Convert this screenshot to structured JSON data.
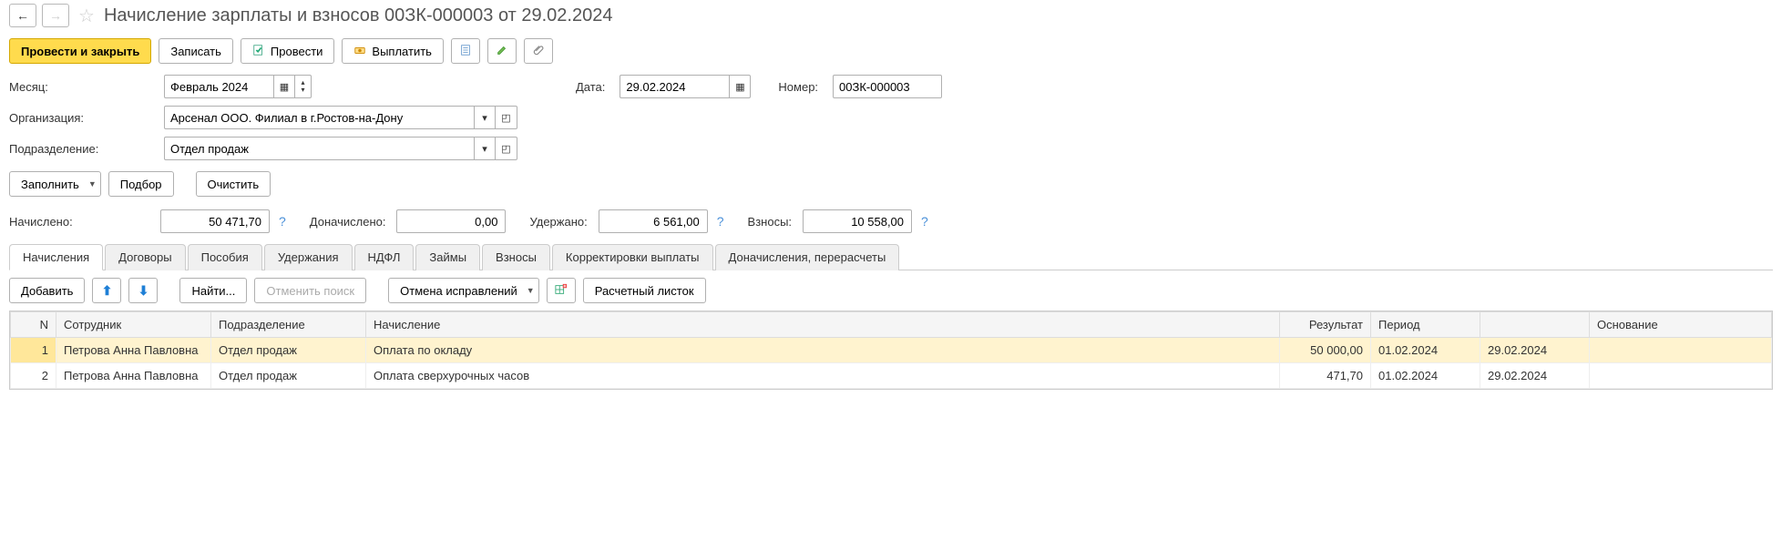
{
  "header": {
    "title": "Начисление зарплаты и взносов 00ЗК-000003 от 29.02.2024"
  },
  "toolbar": {
    "post_and_close": "Провести и закрыть",
    "save": "Записать",
    "post": "Провести",
    "pay": "Выплатить"
  },
  "form": {
    "month_label": "Месяц:",
    "month_value": "Февраль 2024",
    "date_label": "Дата:",
    "date_value": "29.02.2024",
    "number_label": "Номер:",
    "number_value": "00ЗК-000003",
    "org_label": "Организация:",
    "org_value": "Арсенал ООО. Филиал в г.Ростов-на-Дону",
    "dept_label": "Подразделение:",
    "dept_value": "Отдел продаж"
  },
  "actions": {
    "fill": "Заполнить",
    "select": "Подбор",
    "clear": "Очистить"
  },
  "totals": {
    "accrued_label": "Начислено:",
    "accrued_value": "50 471,70",
    "extra_label": "Доначислено:",
    "extra_value": "0,00",
    "withheld_label": "Удержано:",
    "withheld_value": "6 561,00",
    "contrib_label": "Взносы:",
    "contrib_value": "10 558,00"
  },
  "tabs": [
    "Начисления",
    "Договоры",
    "Пособия",
    "Удержания",
    "НДФЛ",
    "Займы",
    "Взносы",
    "Корректировки выплаты",
    "Доначисления, перерасчеты"
  ],
  "tab_toolbar": {
    "add": "Добавить",
    "find": "Найти...",
    "cancel_search": "Отменить поиск",
    "undo_fix": "Отмена исправлений",
    "payslip": "Расчетный листок"
  },
  "grid": {
    "headers": {
      "n": "N",
      "employee": "Сотрудник",
      "dept": "Подразделение",
      "accrual": "Начисление",
      "result": "Результат",
      "period": "Период",
      "period2": "",
      "basis": "Основание"
    },
    "rows": [
      {
        "n": "1",
        "employee": "Петрова Анна Павловна",
        "dept": "Отдел продаж",
        "accrual": "Оплата по окладу",
        "result": "50 000,00",
        "p1": "01.02.2024",
        "p2": "29.02.2024",
        "basis": "",
        "selected": true
      },
      {
        "n": "2",
        "employee": "Петрова Анна Павловна",
        "dept": "Отдел продаж",
        "accrual": "Оплата сверхурочных часов",
        "result": "471,70",
        "p1": "01.02.2024",
        "p2": "29.02.2024",
        "basis": "",
        "selected": false
      }
    ]
  }
}
